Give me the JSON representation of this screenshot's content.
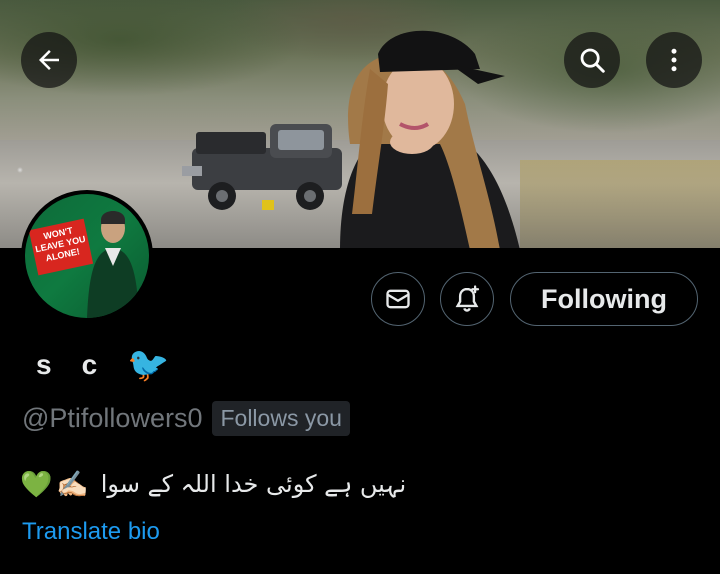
{
  "header": {
    "back_icon": "arrow-left-icon",
    "search_icon": "search-icon",
    "more_icon": "more-vertical-icon"
  },
  "profile": {
    "avatar_sign_text": "WON'T LEAVE YOU ALONE!",
    "display_name_letters": [
      "s",
      "c"
    ],
    "display_name_emoji": "🐦",
    "handle": "@Ptifollowers0",
    "follows_you_label": "Follows you",
    "bio_emoji_start": "💚",
    "bio_emoji_hand": "✍🏻",
    "bio_text": "نہیں ہے کوئی خدا اللہ کے سوا",
    "translate_label": "Translate bio"
  },
  "actions": {
    "message_icon": "mail-icon",
    "notify_icon": "bell-plus-icon",
    "following_label": "Following"
  },
  "colors": {
    "background": "#000000",
    "text": "#e7e9ea",
    "muted": "#71767b",
    "link": "#1d9bf0",
    "border": "#536471"
  }
}
